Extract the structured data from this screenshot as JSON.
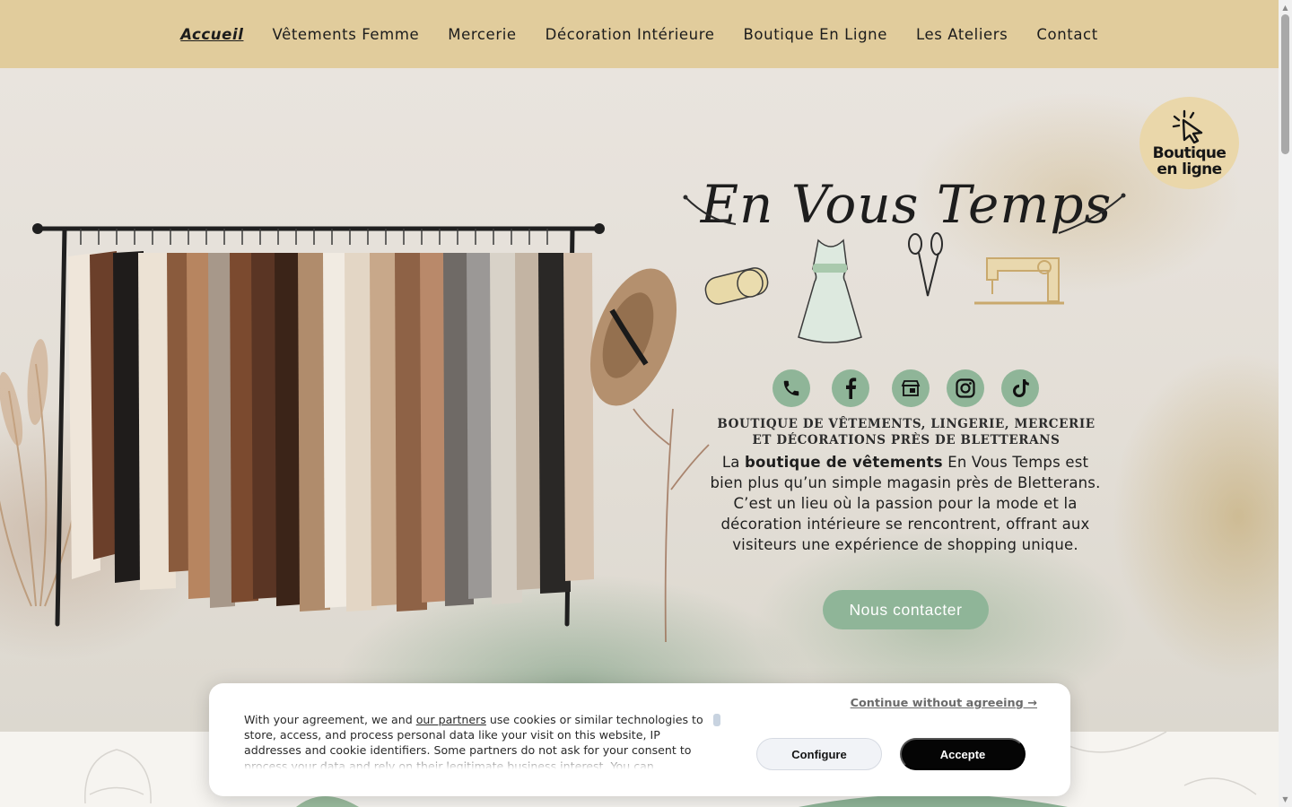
{
  "nav": {
    "items": [
      {
        "label": "Accueil",
        "active": true
      },
      {
        "label": "Vêtements Femme",
        "active": false
      },
      {
        "label": "Mercerie",
        "active": false
      },
      {
        "label": "Décoration Intérieure",
        "active": false
      },
      {
        "label": "Boutique En Ligne",
        "active": false
      },
      {
        "label": "Les Ateliers",
        "active": false
      },
      {
        "label": "Contact",
        "active": false
      }
    ]
  },
  "hero": {
    "badge_label": "Boutique en ligne",
    "badge_icon": "cursor-click-icon",
    "brand_name": "En Vous Temps",
    "illustrations": [
      "tape-measure-icon",
      "dress-icon",
      "scissors-icon",
      "sewing-machine-icon"
    ],
    "socials": [
      {
        "name": "phone-icon"
      },
      {
        "name": "facebook-icon"
      },
      {
        "name": "google-business-icon"
      },
      {
        "name": "instagram-icon"
      },
      {
        "name": "tiktok-icon"
      }
    ],
    "tagline": "Boutique de vêtements, lingerie, mercerie et décorations près de Bletterans",
    "desc_prefix": "La ",
    "desc_bold": "boutique de vêtements",
    "desc_rest": " En Vous Temps est bien plus qu’un simple magasin près de Bletterans. C’est un lieu où la passion pour la mode et la décoration intérieure se rencontrent, offrant aux visiteurs une expérience de shopping unique.",
    "cta_label": "Nous contacter"
  },
  "cookie": {
    "text_before_link": "With your agreement, we and ",
    "link_label": "our partners",
    "text_after_link": " use cookies or similar technologies to store, access, and process personal data like your visit on this website, IP addresses and cookie identifiers. Some partners do not ask for your consent to process your data and rely on their legitimate business interest. You can",
    "continue_label": "Continue without agreeing →",
    "configure_label": "Configure",
    "accept_label": "Accepte"
  },
  "colors": {
    "nav_bg": "#e1cc9c",
    "accent_green": "#8fb598",
    "badge_bg": "#ead7aa",
    "accept_bg": "#050505"
  }
}
